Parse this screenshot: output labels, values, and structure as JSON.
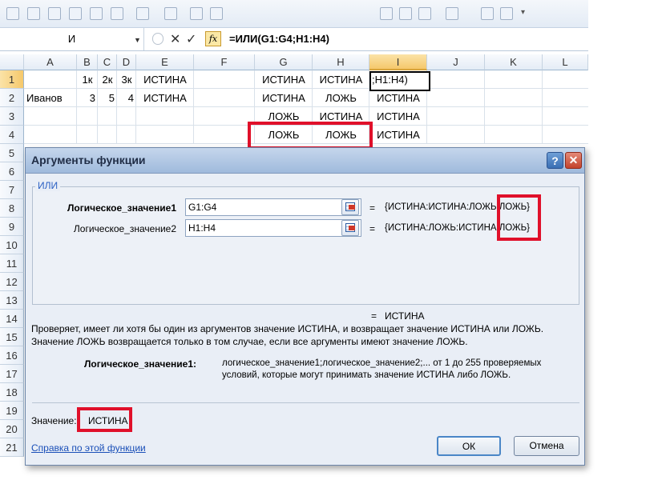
{
  "formula_bar": {
    "name_box": "И",
    "fx": "fx",
    "formula": "=ИЛИ(G1:G4;H1:H4)"
  },
  "columns": [
    "A",
    "B",
    "C",
    "D",
    "E",
    "F",
    "G",
    "H",
    "I",
    "J",
    "K",
    "L"
  ],
  "rows": [
    "1",
    "2",
    "3",
    "4",
    "5",
    "6",
    "7",
    "8",
    "9",
    "10",
    "11",
    "12",
    "13",
    "14",
    "15",
    "16",
    "17",
    "18",
    "19",
    "20",
    "21"
  ],
  "cells": {
    "B1": "1к",
    "C1": "2к",
    "D1": "3к",
    "E1": "ИСТИНА",
    "G1": "ИСТИНА",
    "H1": "ИСТИНА",
    "I1": ";H1:H4)",
    "A2": "Иванов",
    "B2": "3",
    "C2": "5",
    "D2": "4",
    "E2": "ИСТИНА",
    "G2": "ИСТИНА",
    "H2": "ЛОЖЬ",
    "I2": "ИСТИНА",
    "G3": "ЛОЖЬ",
    "H3": "ИСТИНА",
    "I3": "ИСТИНА",
    "G4": "ЛОЖЬ",
    "H4": "ЛОЖЬ",
    "I4": "ИСТИНА"
  },
  "dialog": {
    "title": "Аргументы функции",
    "help_icon": "?",
    "close_icon": "✕",
    "function_name": "ИЛИ",
    "arg1_label": "Логическое_значение1",
    "arg1_value": "G1:G4",
    "arg1_result": "{ИСТИНА:ИСТИНА:ЛОЖЬ:ЛОЖЬ}",
    "arg2_label": "Логическое_значение2",
    "arg2_value": "H1:H4",
    "arg2_result": "{ИСТИНА:ЛОЖЬ:ИСТИНА:ЛОЖЬ}",
    "eq": "=",
    "result": "ИСТИНА",
    "description_1": "Проверяет, имеет ли хотя бы один из аргументов значение ИСТИНА, и возвращает значение ИСТИНА или ЛОЖЬ.",
    "description_2": "Значение ЛОЖЬ возвращается только в том случае, если все аргументы имеют значение ЛОЖЬ.",
    "arg_help_name": "Логическое_значение1:",
    "arg_help_text_1": "логическое_значение1;логическое_значение2;... от 1 до 255 проверяемых",
    "arg_help_text_2": "условий, которые могут принимать значение ИСТИНА либо ЛОЖЬ.",
    "value_label": "Значение:",
    "value_result": "ИСТИНА",
    "help_link": "Справка по этой функции",
    "ok_label": "ОК",
    "cancel_label": "Отмена"
  },
  "colors": {
    "highlight": "#e0102a",
    "selected_header": "#f5c86b",
    "dialog_bg": "#e9eef6"
  }
}
